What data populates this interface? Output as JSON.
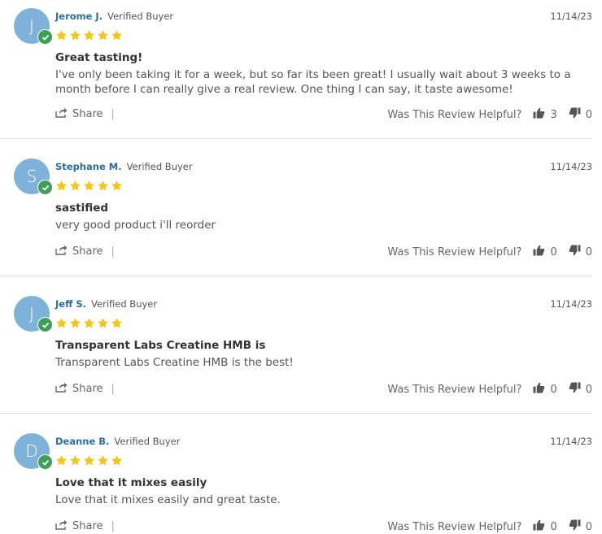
{
  "verified_label": "Verified Buyer",
  "helpful_label": "Was This Review Helpful?",
  "share_label": "Share",
  "share_sep": "|",
  "colors": {
    "avatar": "#7eb2d9",
    "check": "#3ea058",
    "star": "#f5c518",
    "name": "#2b6ea3"
  },
  "reviews": [
    {
      "initial": "J",
      "name": "Jerome J.",
      "date": "11/14/23",
      "rating": 5,
      "title": "Great tasting!",
      "body": "I've only been taking it for a week, but so far its been great! I usually wait about 3 weeks to a month before I can really give a real review. One thing I can say, it taste awesome!",
      "up": "3",
      "down": "0"
    },
    {
      "initial": "S",
      "name": "Stephane M.",
      "date": "11/14/23",
      "rating": 5,
      "title": "sastified",
      "body": "very good product i'll reorder",
      "up": "0",
      "down": "0"
    },
    {
      "initial": "J",
      "name": "Jeff S.",
      "date": "11/14/23",
      "rating": 5,
      "title": "Transparent Labs Creatine HMB is",
      "body": "Transparent Labs Creatine HMB is the best!",
      "up": "0",
      "down": "0"
    },
    {
      "initial": "D",
      "name": "Deanne B.",
      "date": "11/14/23",
      "rating": 5,
      "title": "Love that it mixes easily",
      "body": "Love that it mixes easily and great taste.",
      "up": "0",
      "down": "0"
    }
  ]
}
